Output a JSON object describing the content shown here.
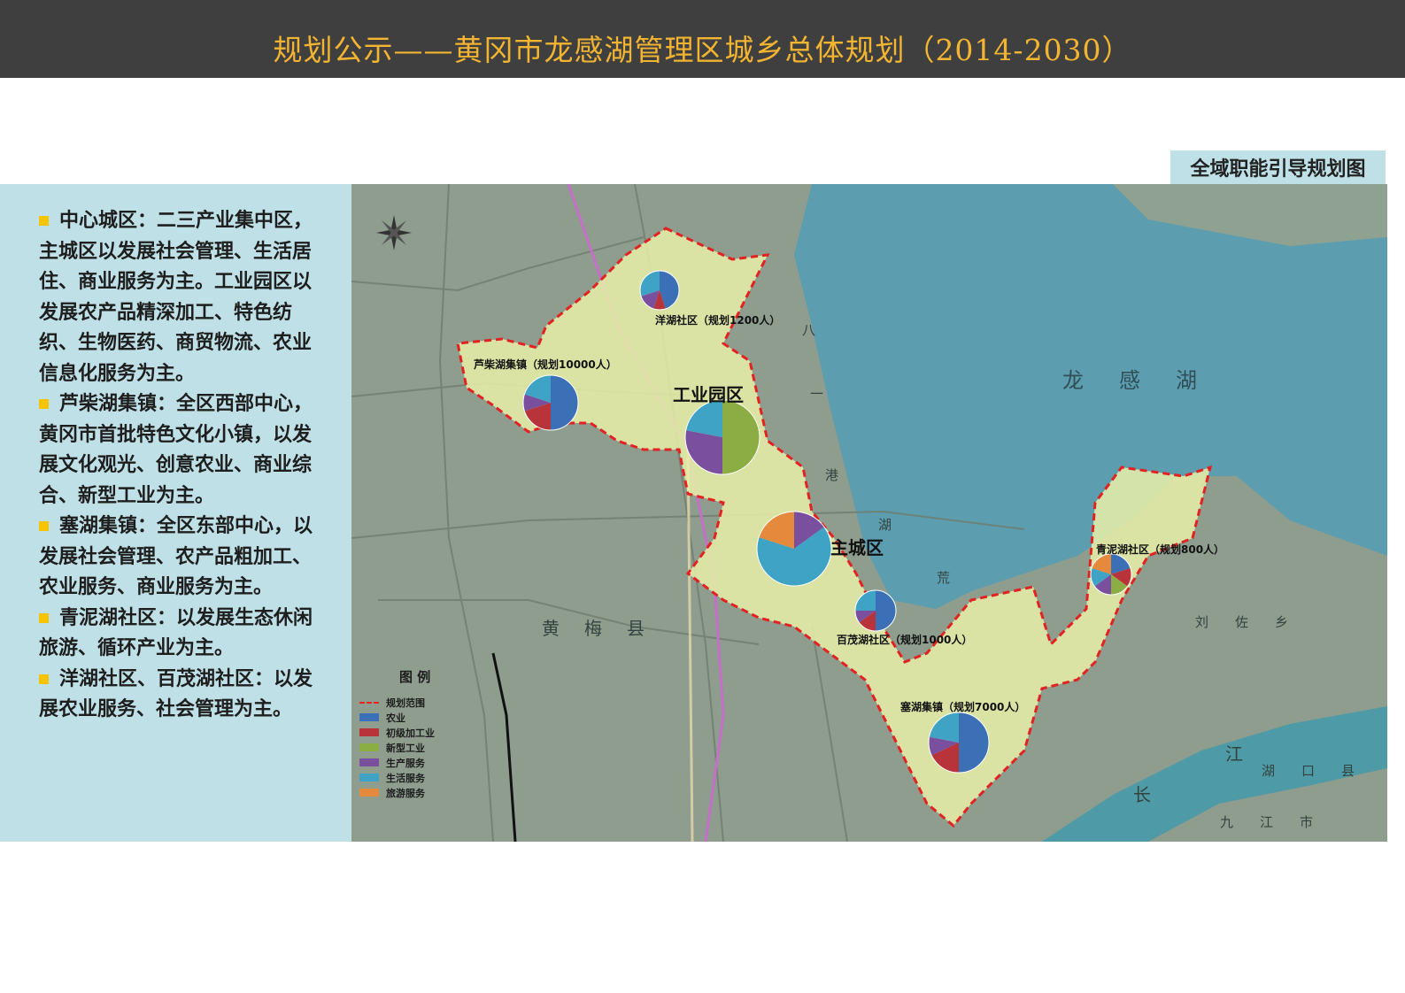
{
  "header": {
    "title": "规划公示——黄冈市龙感湖管理区城乡总体规划（2014-2030）"
  },
  "map_title": "全域职能引导规划图",
  "description": [
    {
      "head": "中心城区：",
      "text": "二三产业集中区，主城区以发展社会管理、生活居住、商业服务为主。工业园区以发展农产品精深加工、特色纺织、生物医药、商贸物流、农业信息化服务为主。"
    },
    {
      "head": "芦柴湖集镇：",
      "text": "全区西部中心，黄冈市首批特色文化小镇，以发展文化观光、创意农业、商业综合、新型工业为主。"
    },
    {
      "head": "塞湖集镇：",
      "text": "全区东部中心，以发展社会管理、农产品粗加工、农业服务、商业服务为主。"
    },
    {
      "head": "青泥湖社区：",
      "text": "以发展生态休闲旅游、循环产业为主。"
    },
    {
      "head": "洋湖社区、百茂湖社区：",
      "text": "以发展农业服务、社会管理为主。"
    }
  ],
  "legend": {
    "title": "图  例",
    "items": [
      {
        "label": "规划范围",
        "color": "#e22222",
        "style": "dashed"
      },
      {
        "label": "农业",
        "color": "#3b6fb6"
      },
      {
        "label": "初级加工业",
        "color": "#b8343a"
      },
      {
        "label": "新型工业",
        "color": "#8cad44"
      },
      {
        "label": "生产服务",
        "color": "#7a4f9d"
      },
      {
        "label": "生活服务",
        "color": "#3ea3c4"
      },
      {
        "label": "旅游服务",
        "color": "#e58a3c"
      }
    ]
  },
  "nodes": {
    "yanghu": "洋湖社区（规划1200人）",
    "luchaihu": "芦柴湖集镇（规划10000人）",
    "industrial": "工业园区",
    "main_city": "主城区",
    "baimaohu": "百茂湖社区（规划1000人）",
    "saihu": "塞湖集镇（规划7000人）",
    "qingnihu": "青泥湖社区（规划800人）"
  },
  "place_names": {
    "lake": "龙感湖",
    "huangmei": "黄梅县",
    "liuzuo": "刘佐乡",
    "jiangjiang": "江",
    "hukou": "湖口县",
    "jiujiang": "九江市",
    "chang": "长",
    "bagang_1": "八",
    "bagang_2": "一",
    "bagang_3": "港",
    "huang_1": "湖",
    "huang_2": "荒"
  },
  "map_colors": {
    "land": "#8e9d8e",
    "lake": "#5c9db0",
    "river": "#4e9aa6",
    "zone_fill": "#e7f0a8",
    "boundary": "#e22222"
  }
}
